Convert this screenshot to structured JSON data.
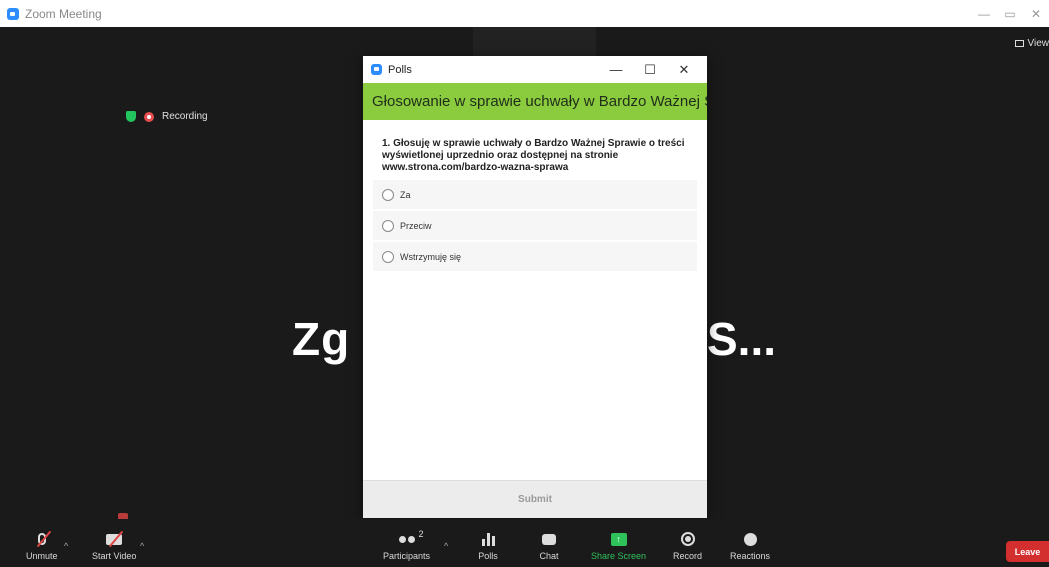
{
  "window": {
    "title": "Zoom Meeting",
    "controls": [
      "—",
      "▭",
      "✕"
    ]
  },
  "meeting": {
    "view_label": "View",
    "recording_label": "Recording",
    "name_left": "Zg",
    "name_right": "S..."
  },
  "polls_window": {
    "title": "Polls",
    "controls": [
      "—",
      "☐",
      "✕"
    ],
    "header": "Głosowanie w sprawie uchwały w Bardzo Ważnej Sp...",
    "question": "1. Głosuję w sprawie uchwały o Bardzo Ważnej Sprawie o treści wyświetlonej uprzednio oraz dostępnej na stronie www.strona.com/bardzo-wazna-sprawa",
    "options": [
      "Za",
      "Przeciw",
      "Wstrzymuję się"
    ],
    "submit_label": "Submit"
  },
  "toolbar": {
    "unmute": "Unmute",
    "start_video": "Start Video",
    "participants": "Participants",
    "participants_count": "2",
    "polls": "Polls",
    "chat": "Chat",
    "share_screen": "Share Screen",
    "record": "Record",
    "reactions": "Reactions",
    "leave": "Leave"
  },
  "colors": {
    "poll_header": "#8bcc3f",
    "share_green": "#2fc25b",
    "leave_red": "#d32f2f",
    "zoom_blue": "#2d8cff"
  }
}
